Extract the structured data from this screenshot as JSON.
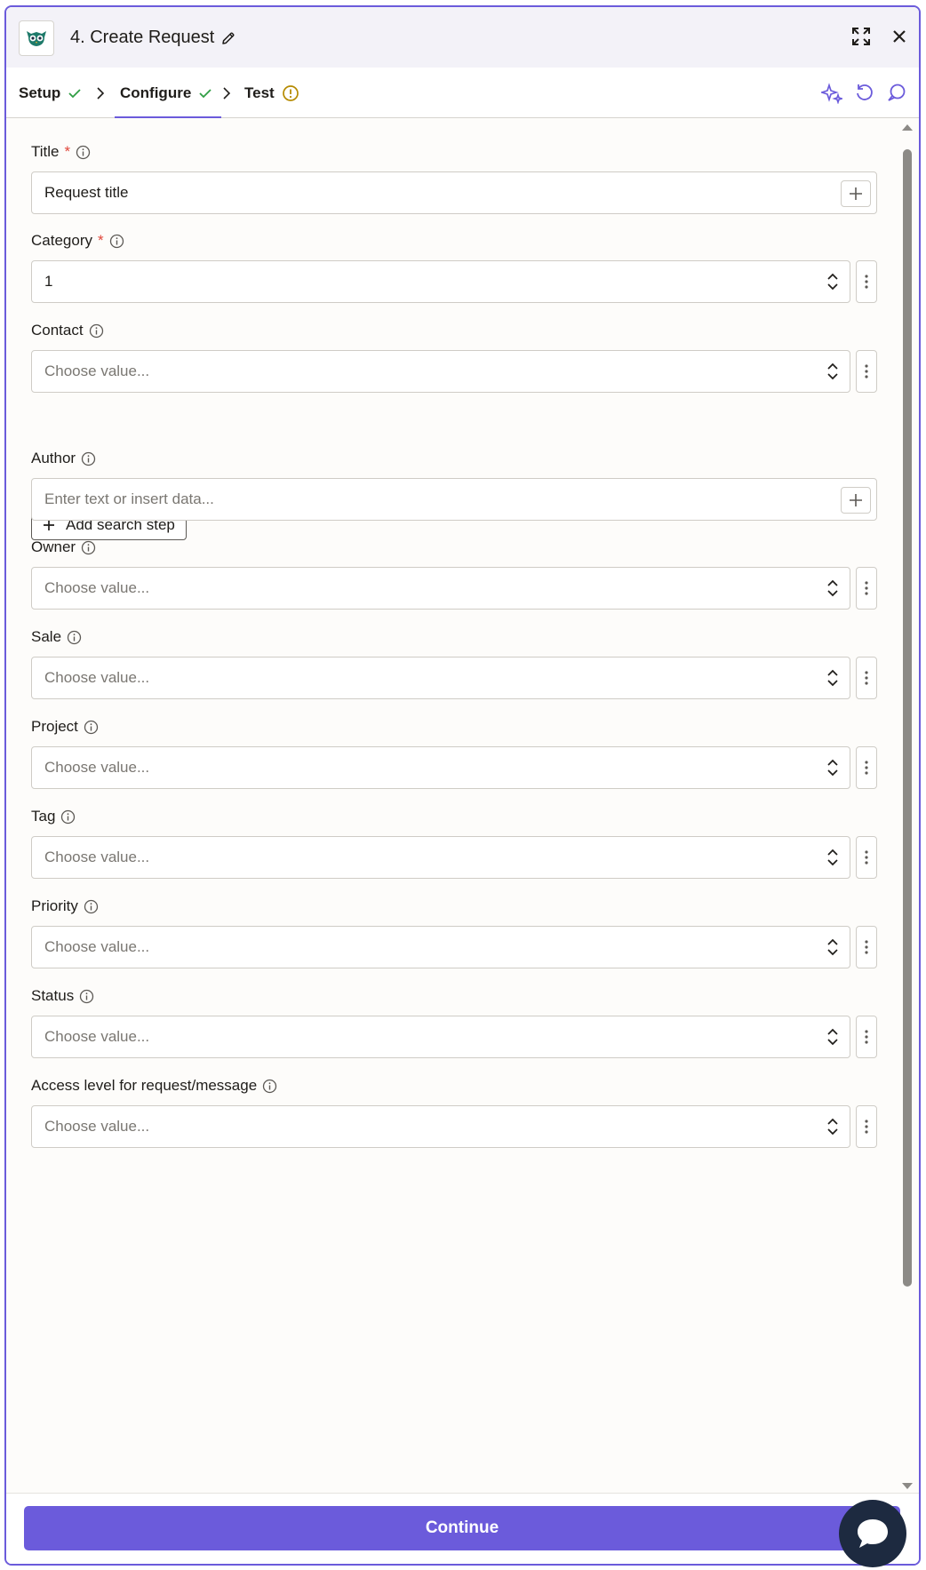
{
  "header": {
    "title": "4. Create Request"
  },
  "tabs": [
    {
      "label": "Setup",
      "status": "complete"
    },
    {
      "label": "Configure",
      "status": "complete"
    },
    {
      "label": "Test",
      "status": "warning"
    }
  ],
  "fields": [
    {
      "label": "Title",
      "required": true,
      "type": "text",
      "value": "Request title",
      "placeholder": ""
    },
    {
      "label": "Category",
      "required": true,
      "type": "select",
      "value": "1",
      "placeholder": ""
    },
    {
      "label": "Contact",
      "required": false,
      "type": "select",
      "value": "",
      "placeholder": "Choose value..."
    },
    {
      "label": "Author",
      "required": false,
      "type": "text",
      "value": "",
      "placeholder": "Enter text or insert data..."
    },
    {
      "label": "Owner",
      "required": false,
      "type": "select",
      "value": "",
      "placeholder": "Choose value..."
    },
    {
      "label": "Sale",
      "required": false,
      "type": "select",
      "value": "",
      "placeholder": "Choose value..."
    },
    {
      "label": "Project",
      "required": false,
      "type": "select",
      "value": "",
      "placeholder": "Choose value..."
    },
    {
      "label": "Tag",
      "required": false,
      "type": "select",
      "value": "",
      "placeholder": "Choose value..."
    },
    {
      "label": "Priority",
      "required": false,
      "type": "select",
      "value": "",
      "placeholder": "Choose value..."
    },
    {
      "label": "Status",
      "required": false,
      "type": "select",
      "value": "",
      "placeholder": "Choose value..."
    },
    {
      "label": "Access level for request/message",
      "required": false,
      "type": "select",
      "value": "",
      "placeholder": "Choose value..."
    }
  ],
  "required_marker": "*",
  "add_search_step_label": "Add search step",
  "footer": {
    "continue_label": "Continue"
  },
  "colors": {
    "accent": "#6b5bdb",
    "success": "#2f9e44",
    "warning": "#b58a00",
    "required": "#e0463a"
  }
}
